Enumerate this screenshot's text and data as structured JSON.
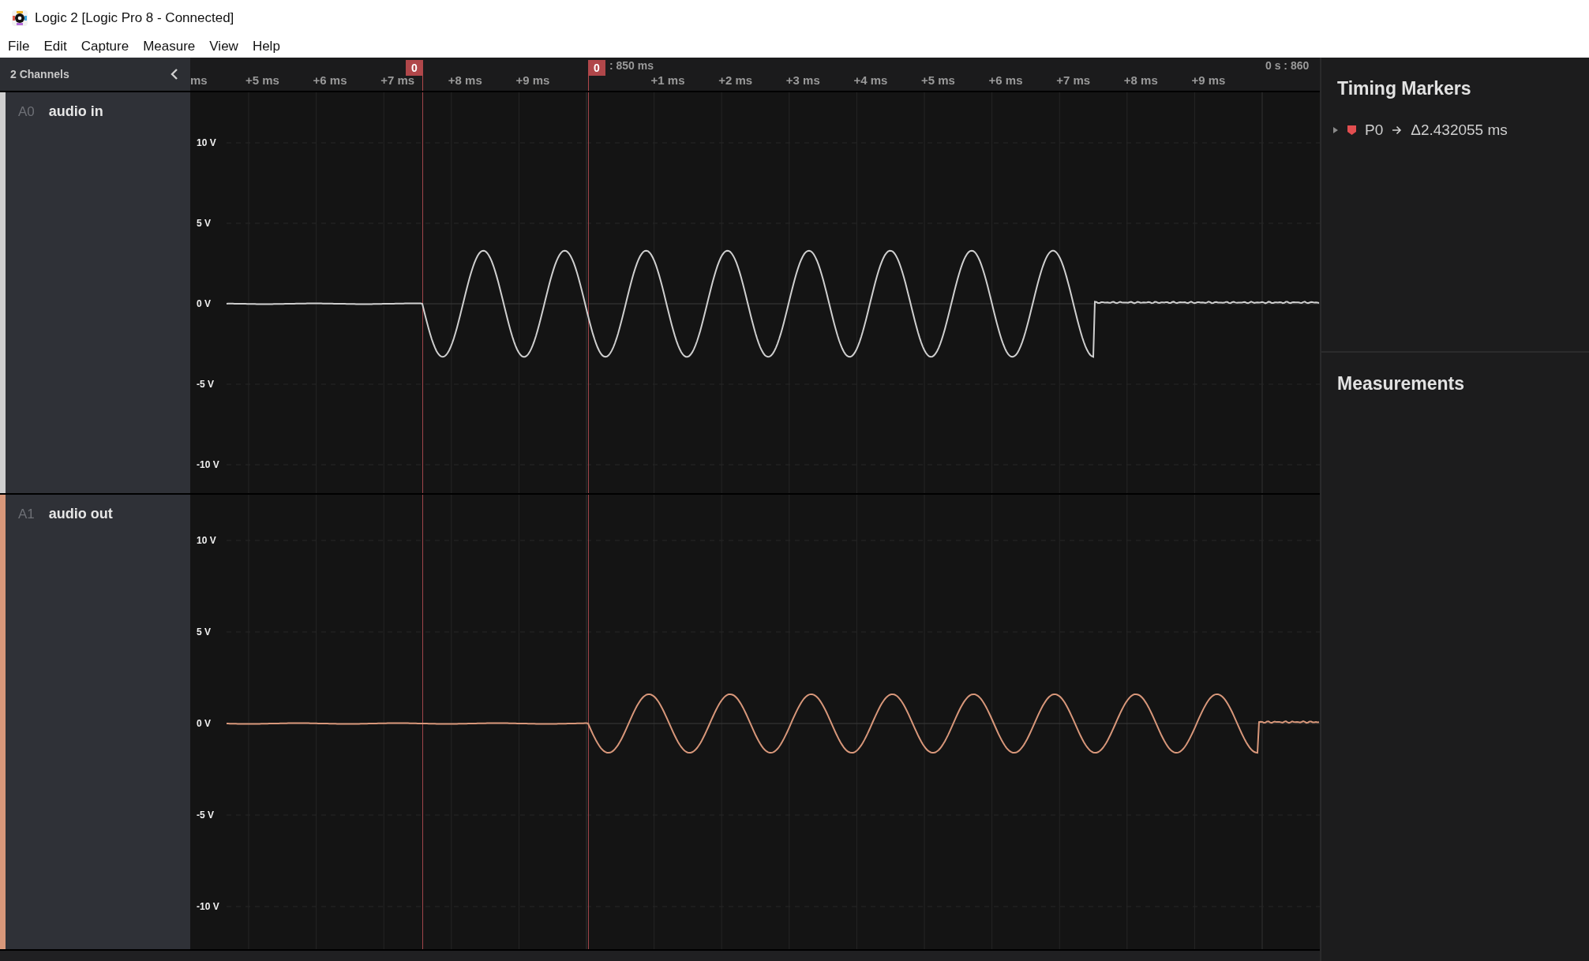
{
  "window": {
    "title": "Logic 2 [Logic Pro 8 - Connected]"
  },
  "menu": [
    "File",
    "Edit",
    "Capture",
    "Measure",
    "View",
    "Help"
  ],
  "channels_header": {
    "title": "2 Channels"
  },
  "ruler": {
    "ticks": [
      {
        "label": "ms",
        "kind": "minor"
      },
      {
        "label": "+5 ms",
        "kind": "minor"
      },
      {
        "label": "+6 ms",
        "kind": "minor"
      },
      {
        "label": "+7 ms",
        "kind": "minor"
      },
      {
        "label": "+8 ms",
        "kind": "minor"
      },
      {
        "label": "+9 ms",
        "kind": "minor"
      },
      {
        "label": ": 850 ms",
        "kind": "major"
      },
      {
        "label": "+1 ms",
        "kind": "minor"
      },
      {
        "label": "+2 ms",
        "kind": "minor"
      },
      {
        "label": "+3 ms",
        "kind": "minor"
      },
      {
        "label": "+4 ms",
        "kind": "minor"
      },
      {
        "label": "+5 ms",
        "kind": "minor"
      },
      {
        "label": "+6 ms",
        "kind": "minor"
      },
      {
        "label": "+7 ms",
        "kind": "minor"
      },
      {
        "label": "+8 ms",
        "kind": "minor"
      },
      {
        "label": "+9 ms",
        "kind": "minor"
      },
      {
        "label": "0 s : 860",
        "kind": "major"
      }
    ],
    "markers": [
      {
        "label": "0"
      },
      {
        "label": "0"
      }
    ]
  },
  "channels": [
    {
      "id": "A0",
      "name": "audio in",
      "color": "#cfcfcf",
      "y_labels": [
        "10 V",
        "5 V",
        "0 V",
        "-5 V",
        "-10 V"
      ]
    },
    {
      "id": "A1",
      "name": "audio out",
      "color": "#d8977a",
      "y_labels": [
        "10 V",
        "5 V",
        "0 V",
        "-5 V",
        "-10 V"
      ]
    }
  ],
  "timing_markers": {
    "title": "Timing Markers",
    "items": [
      {
        "name": "P0",
        "delta": "Δ2.432055 ms",
        "expanded": false
      }
    ]
  },
  "measurements": {
    "title": "Measurements"
  }
}
